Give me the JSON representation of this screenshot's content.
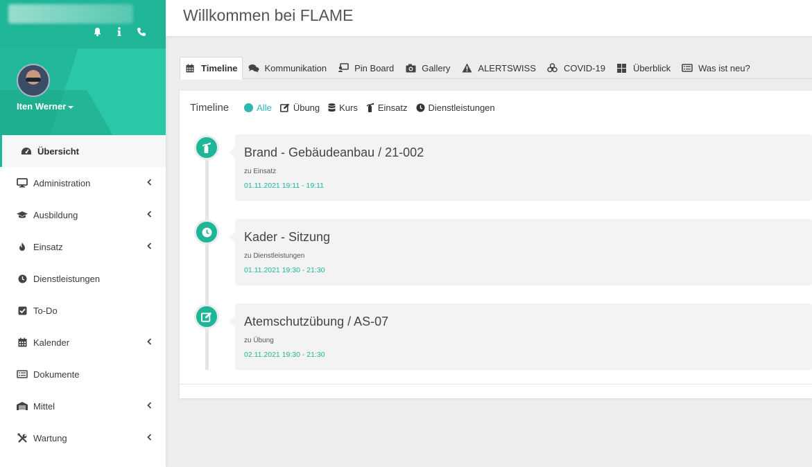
{
  "header": {
    "title": "Willkommen bei FLAME"
  },
  "sidebar": {
    "user": {
      "name": "Iten Werner"
    },
    "top_icons": [
      "bell-icon",
      "info-icon",
      "phone-icon"
    ],
    "items": [
      {
        "label": "Übersicht",
        "icon": "dashboard-icon",
        "active": true,
        "has_submenu": false
      },
      {
        "label": "Administration",
        "icon": "monitor-icon",
        "has_submenu": true
      },
      {
        "label": "Ausbildung",
        "icon": "graduation-cap-icon",
        "has_submenu": true
      },
      {
        "label": "Einsatz",
        "icon": "fire-icon",
        "has_submenu": true
      },
      {
        "label": "Dienstleistungen",
        "icon": "clock-icon",
        "has_submenu": false
      },
      {
        "label": "To-Do",
        "icon": "checkbox-icon",
        "has_submenu": false
      },
      {
        "label": "Kalender",
        "icon": "calendar-icon",
        "has_submenu": true
      },
      {
        "label": "Dokumente",
        "icon": "document-list-icon",
        "has_submenu": false
      },
      {
        "label": "Mittel",
        "icon": "warehouse-icon",
        "has_submenu": true
      },
      {
        "label": "Wartung",
        "icon": "tools-icon",
        "has_submenu": true
      }
    ]
  },
  "tabs": [
    {
      "label": "Timeline",
      "icon": "calendar-icon",
      "active": true
    },
    {
      "label": "Kommunikation",
      "icon": "comments-icon"
    },
    {
      "label": "Pin Board",
      "icon": "pinboard-icon"
    },
    {
      "label": "Gallery",
      "icon": "camera-icon"
    },
    {
      "label": "ALERTSWISS",
      "icon": "warning-icon"
    },
    {
      "label": "COVID-19",
      "icon": "biohazard-icon"
    },
    {
      "label": "Überblick",
      "icon": "grid-icon"
    },
    {
      "label": "Was ist neu?",
      "icon": "list-card-icon"
    }
  ],
  "timeline": {
    "title": "Timeline",
    "filters": [
      {
        "label": "Alle",
        "icon": "dot-icon",
        "active": true
      },
      {
        "label": "Übung",
        "icon": "edit-icon"
      },
      {
        "label": "Kurs",
        "icon": "database-icon"
      },
      {
        "label": "Einsatz",
        "icon": "fire-extinguisher-icon"
      },
      {
        "label": "Dienstleistungen",
        "icon": "clock-icon"
      }
    ],
    "entries": [
      {
        "title": "Brand - Gebäudeanbau / 21-002",
        "category": "zu Einsatz",
        "time": "01.11.2021 19:11 - 19:11",
        "icon": "fire-extinguisher-icon"
      },
      {
        "title": "Kader - Sitzung",
        "category": "zu Dienstleistungen",
        "time": "01.11.2021 19:30 - 21:30",
        "icon": "clock-icon"
      },
      {
        "title": "Atemschutzübung / AS-07",
        "category": "zu Übung",
        "time": "02.11.2021 19:30 - 21:30",
        "icon": "edit-icon"
      }
    ]
  },
  "colors": {
    "accent": "#1fb597",
    "filter_active": "#2cb8b0"
  }
}
